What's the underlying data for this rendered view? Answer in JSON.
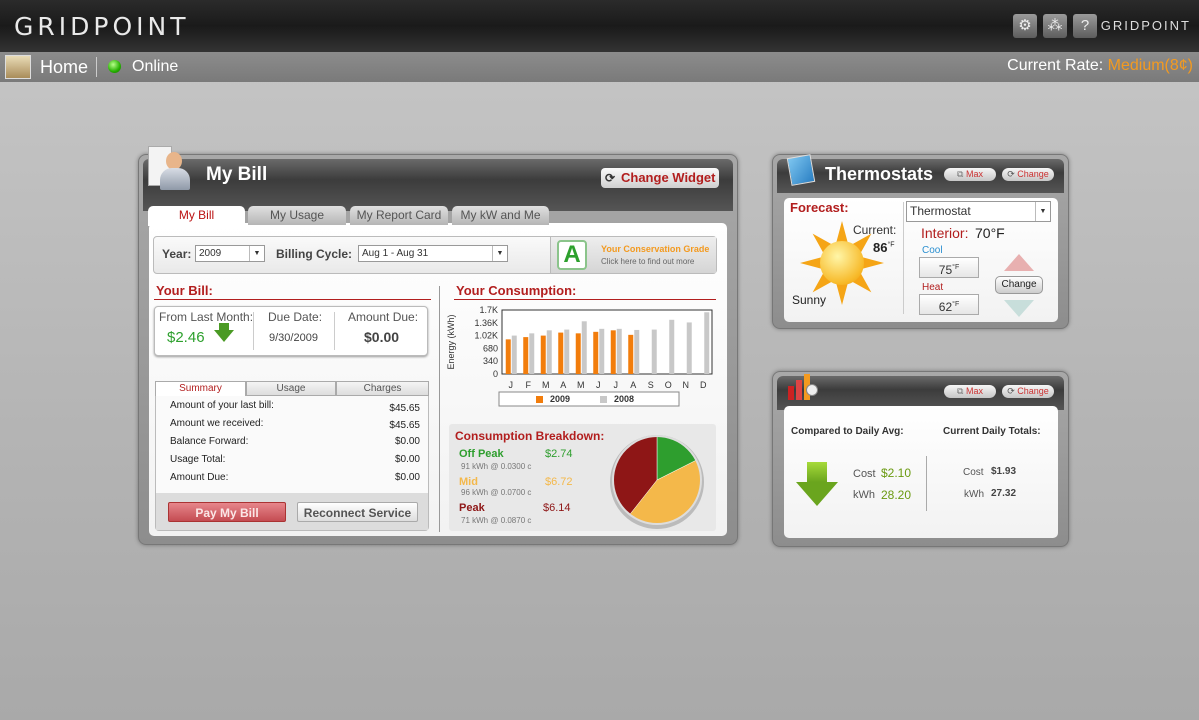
{
  "topbar": {
    "logo": "GRIDPOINT",
    "logo_small": "GRIDPOINT",
    "icons": [
      "gear-icon",
      "network-icon",
      "help-icon"
    ]
  },
  "subbar": {
    "home": "Home",
    "status": "Online",
    "rate_label": "Current Rate:",
    "rate_value": "Medium(8¢)"
  },
  "bill": {
    "title": "My Bill",
    "change_widget": "Change Widget",
    "tabs": [
      "My Bill",
      "My Usage",
      "My Report Card",
      "My kW and Me"
    ],
    "year_label": "Year:",
    "year_value": "2009",
    "cycle_label": "Billing Cycle:",
    "cycle_value": "Aug 1 - Aug 31",
    "grade": "A",
    "grade_title": "Your Conservation Grade",
    "grade_sub": "Click here to find out more",
    "your_bill": "Your Bill:",
    "from_last_label": "From Last Month:",
    "from_last_value": "$2.46",
    "due_label": "Due Date:",
    "due_value": "9/30/2009",
    "amount_label": "Amount Due:",
    "amount_value": "$0.00",
    "subtabs": [
      "Summary",
      "Usage",
      "Charges"
    ],
    "rows": [
      {
        "label": "Amount of your last bill:",
        "value": "$45.65"
      },
      {
        "label": "Amount we received:",
        "value": "$45.65"
      },
      {
        "label": "Balance Forward:",
        "value": "$0.00"
      },
      {
        "label": "Usage Total:",
        "value": "$0.00"
      },
      {
        "label": "Amount Due:",
        "value": "$0.00"
      }
    ],
    "pay_button": "Pay My Bill",
    "reconnect_button": "Reconnect Service",
    "consumption_title": "Your Consumption:",
    "breakdown_title": "Consumption Breakdown:",
    "breakdown": [
      {
        "name": "Off Peak",
        "value": "$2.74",
        "detail": "91 kWh @ 0.0300 c",
        "color": "#2e9e2e"
      },
      {
        "name": "Mid",
        "value": "$6.72",
        "detail": "96 kWh @ 0.0700 c",
        "color": "#f4b84a"
      },
      {
        "name": "Peak",
        "value": "$6.14",
        "detail": "71 kWh @ 0.0870 c",
        "color": "#8e1616"
      }
    ]
  },
  "chart_data": {
    "type": "bar",
    "ylabel": "Energy (kWh)",
    "yticks": [
      "1.7K",
      "1.36K",
      "1.02K",
      "680",
      "340",
      "0"
    ],
    "ylim": [
      0,
      1700
    ],
    "categories": [
      "J",
      "F",
      "M",
      "A",
      "M",
      "J",
      "J",
      "A",
      "S",
      "O",
      "N",
      "D"
    ],
    "series": [
      {
        "name": "2009",
        "color": "#f27d0c",
        "values": [
          920,
          980,
          1020,
          1100,
          1080,
          1120,
          1160,
          1040,
          null,
          null,
          null,
          null
        ]
      },
      {
        "name": "2008",
        "color": "#c8c8c8",
        "values": [
          1020,
          1080,
          1160,
          1180,
          1400,
          1200,
          1200,
          1170,
          1180,
          1440,
          1370,
          1640
        ]
      }
    ]
  },
  "pie_data": {
    "type": "pie",
    "slices": [
      {
        "name": "Off Peak",
        "value": 2.74
      },
      {
        "name": "Mid",
        "value": 6.72
      },
      {
        "name": "Peak",
        "value": 6.14
      }
    ]
  },
  "thermostat": {
    "title": "Thermostats",
    "max": "Max",
    "change": "Change",
    "forecast_label": "Forecast:",
    "current_label": "Current:",
    "current_value": "86",
    "unit": "°F",
    "weather": "Sunny",
    "select_value": "Thermostat",
    "interior_label": "Interior:",
    "interior_value": "70°F",
    "cool_label": "Cool",
    "cool_value": "75",
    "heat_label": "Heat",
    "heat_value": "62",
    "change_button": "Change"
  },
  "daily": {
    "max": "Max",
    "change": "Change",
    "compared_label": "Compared to Daily Avg:",
    "current_label": "Current Daily Totals:",
    "cost_label": "Cost",
    "kwh_label": "kWh",
    "avg_cost": "$2.10",
    "avg_kwh": "28.20",
    "cur_cost": "$1.93",
    "cur_kwh": "27.32"
  }
}
